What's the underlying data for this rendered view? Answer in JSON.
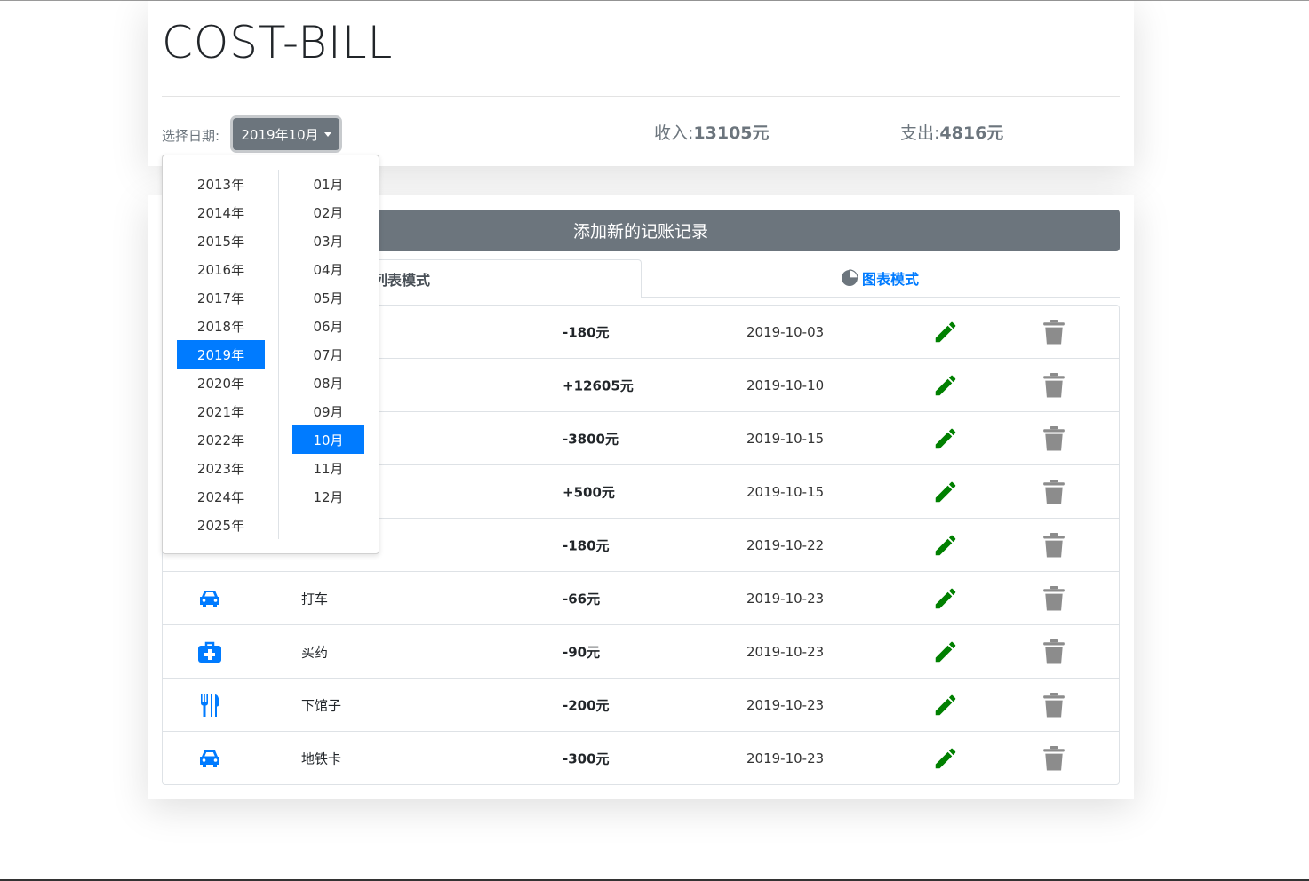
{
  "header": {
    "title": "COST-BILL",
    "date_label": "选择日期:",
    "selected_date": "2019年10月",
    "income_label": "收入:",
    "income_value": "13105元",
    "outcome_label": "支出:",
    "outcome_value": "4816元"
  },
  "main": {
    "add_button": "添加新的记账记录",
    "tabs": [
      {
        "label": "列表模式"
      },
      {
        "label": "图表模式"
      }
    ]
  },
  "records": [
    {
      "icon": "hidden",
      "title": "",
      "price": "-180元",
      "date": "2019-10-03"
    },
    {
      "icon": "hidden",
      "title": "",
      "price": "+12605元",
      "date": "2019-10-10"
    },
    {
      "icon": "hidden",
      "title": "",
      "price": "-3800元",
      "date": "2019-10-15"
    },
    {
      "icon": "hidden",
      "title": "",
      "price": "+500元",
      "date": "2019-10-15"
    },
    {
      "icon": "hidden",
      "title": "",
      "price": "-180元",
      "date": "2019-10-22"
    },
    {
      "icon": "car-icon",
      "title": "打车",
      "price": "-66元",
      "date": "2019-10-23"
    },
    {
      "icon": "medkit-icon",
      "title": "买药",
      "price": "-90元",
      "date": "2019-10-23"
    },
    {
      "icon": "restaurant-icon",
      "title": "下馆子",
      "price": "-200元",
      "date": "2019-10-23"
    },
    {
      "icon": "car-icon",
      "title": "地铁卡",
      "price": "-300元",
      "date": "2019-10-23"
    }
  ],
  "picker": {
    "years": [
      "2013年",
      "2014年",
      "2015年",
      "2016年",
      "2017年",
      "2018年",
      "2019年",
      "2020年",
      "2021年",
      "2022年",
      "2023年",
      "2024年",
      "2025年"
    ],
    "months": [
      "01月",
      "02月",
      "03月",
      "04月",
      "05月",
      "06月",
      "07月",
      "08月",
      "09月",
      "10月",
      "11月",
      "12月"
    ],
    "selected_year": "2019年",
    "selected_month": "10月"
  },
  "colors": {
    "accent": "#007bff",
    "secondary": "#6c757d",
    "edit": "#008000",
    "delete": "#8c8c8c"
  }
}
